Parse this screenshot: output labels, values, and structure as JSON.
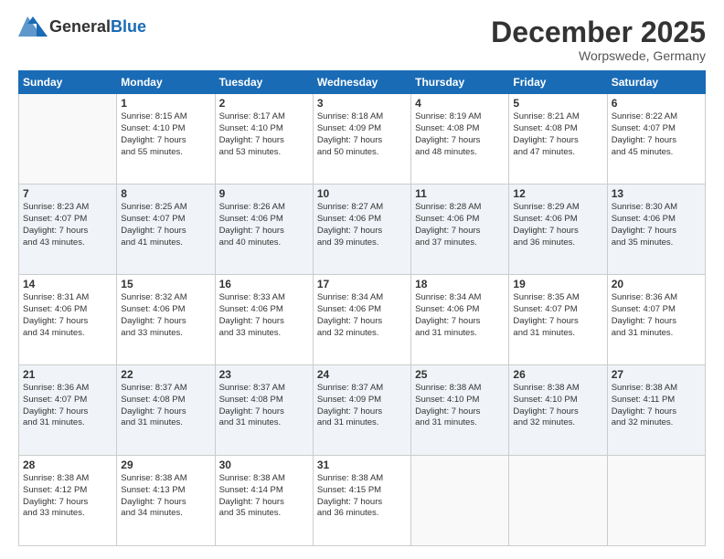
{
  "header": {
    "logo_general": "General",
    "logo_blue": "Blue",
    "month": "December 2025",
    "location": "Worpswede, Germany"
  },
  "days_of_week": [
    "Sunday",
    "Monday",
    "Tuesday",
    "Wednesday",
    "Thursday",
    "Friday",
    "Saturday"
  ],
  "weeks": [
    [
      {
        "day": "",
        "info": ""
      },
      {
        "day": "1",
        "info": "Sunrise: 8:15 AM\nSunset: 4:10 PM\nDaylight: 7 hours\nand 55 minutes."
      },
      {
        "day": "2",
        "info": "Sunrise: 8:17 AM\nSunset: 4:10 PM\nDaylight: 7 hours\nand 53 minutes."
      },
      {
        "day": "3",
        "info": "Sunrise: 8:18 AM\nSunset: 4:09 PM\nDaylight: 7 hours\nand 50 minutes."
      },
      {
        "day": "4",
        "info": "Sunrise: 8:19 AM\nSunset: 4:08 PM\nDaylight: 7 hours\nand 48 minutes."
      },
      {
        "day": "5",
        "info": "Sunrise: 8:21 AM\nSunset: 4:08 PM\nDaylight: 7 hours\nand 47 minutes."
      },
      {
        "day": "6",
        "info": "Sunrise: 8:22 AM\nSunset: 4:07 PM\nDaylight: 7 hours\nand 45 minutes."
      }
    ],
    [
      {
        "day": "7",
        "info": "Sunrise: 8:23 AM\nSunset: 4:07 PM\nDaylight: 7 hours\nand 43 minutes."
      },
      {
        "day": "8",
        "info": "Sunrise: 8:25 AM\nSunset: 4:07 PM\nDaylight: 7 hours\nand 41 minutes."
      },
      {
        "day": "9",
        "info": "Sunrise: 8:26 AM\nSunset: 4:06 PM\nDaylight: 7 hours\nand 40 minutes."
      },
      {
        "day": "10",
        "info": "Sunrise: 8:27 AM\nSunset: 4:06 PM\nDaylight: 7 hours\nand 39 minutes."
      },
      {
        "day": "11",
        "info": "Sunrise: 8:28 AM\nSunset: 4:06 PM\nDaylight: 7 hours\nand 37 minutes."
      },
      {
        "day": "12",
        "info": "Sunrise: 8:29 AM\nSunset: 4:06 PM\nDaylight: 7 hours\nand 36 minutes."
      },
      {
        "day": "13",
        "info": "Sunrise: 8:30 AM\nSunset: 4:06 PM\nDaylight: 7 hours\nand 35 minutes."
      }
    ],
    [
      {
        "day": "14",
        "info": "Sunrise: 8:31 AM\nSunset: 4:06 PM\nDaylight: 7 hours\nand 34 minutes."
      },
      {
        "day": "15",
        "info": "Sunrise: 8:32 AM\nSunset: 4:06 PM\nDaylight: 7 hours\nand 33 minutes."
      },
      {
        "day": "16",
        "info": "Sunrise: 8:33 AM\nSunset: 4:06 PM\nDaylight: 7 hours\nand 33 minutes."
      },
      {
        "day": "17",
        "info": "Sunrise: 8:34 AM\nSunset: 4:06 PM\nDaylight: 7 hours\nand 32 minutes."
      },
      {
        "day": "18",
        "info": "Sunrise: 8:34 AM\nSunset: 4:06 PM\nDaylight: 7 hours\nand 31 minutes."
      },
      {
        "day": "19",
        "info": "Sunrise: 8:35 AM\nSunset: 4:07 PM\nDaylight: 7 hours\nand 31 minutes."
      },
      {
        "day": "20",
        "info": "Sunrise: 8:36 AM\nSunset: 4:07 PM\nDaylight: 7 hours\nand 31 minutes."
      }
    ],
    [
      {
        "day": "21",
        "info": "Sunrise: 8:36 AM\nSunset: 4:07 PM\nDaylight: 7 hours\nand 31 minutes."
      },
      {
        "day": "22",
        "info": "Sunrise: 8:37 AM\nSunset: 4:08 PM\nDaylight: 7 hours\nand 31 minutes."
      },
      {
        "day": "23",
        "info": "Sunrise: 8:37 AM\nSunset: 4:08 PM\nDaylight: 7 hours\nand 31 minutes."
      },
      {
        "day": "24",
        "info": "Sunrise: 8:37 AM\nSunset: 4:09 PM\nDaylight: 7 hours\nand 31 minutes."
      },
      {
        "day": "25",
        "info": "Sunrise: 8:38 AM\nSunset: 4:10 PM\nDaylight: 7 hours\nand 31 minutes."
      },
      {
        "day": "26",
        "info": "Sunrise: 8:38 AM\nSunset: 4:10 PM\nDaylight: 7 hours\nand 32 minutes."
      },
      {
        "day": "27",
        "info": "Sunrise: 8:38 AM\nSunset: 4:11 PM\nDaylight: 7 hours\nand 32 minutes."
      }
    ],
    [
      {
        "day": "28",
        "info": "Sunrise: 8:38 AM\nSunset: 4:12 PM\nDaylight: 7 hours\nand 33 minutes."
      },
      {
        "day": "29",
        "info": "Sunrise: 8:38 AM\nSunset: 4:13 PM\nDaylight: 7 hours\nand 34 minutes."
      },
      {
        "day": "30",
        "info": "Sunrise: 8:38 AM\nSunset: 4:14 PM\nDaylight: 7 hours\nand 35 minutes."
      },
      {
        "day": "31",
        "info": "Sunrise: 8:38 AM\nSunset: 4:15 PM\nDaylight: 7 hours\nand 36 minutes."
      },
      {
        "day": "",
        "info": ""
      },
      {
        "day": "",
        "info": ""
      },
      {
        "day": "",
        "info": ""
      }
    ]
  ]
}
